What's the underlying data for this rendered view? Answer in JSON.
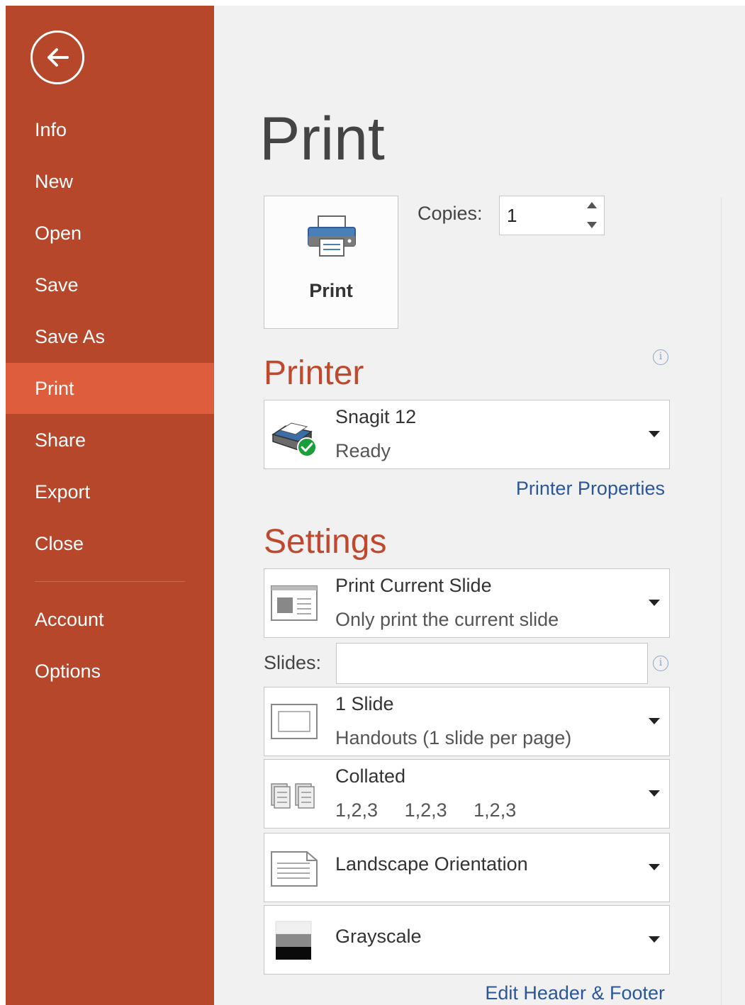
{
  "sidebar": {
    "items": [
      {
        "label": "Info"
      },
      {
        "label": "New"
      },
      {
        "label": "Open"
      },
      {
        "label": "Save"
      },
      {
        "label": "Save As"
      },
      {
        "label": "Print"
      },
      {
        "label": "Share"
      },
      {
        "label": "Export"
      },
      {
        "label": "Close"
      },
      {
        "label": "Account"
      },
      {
        "label": "Options"
      }
    ],
    "active": "Print"
  },
  "main": {
    "title": "Print",
    "print_button_label": "Print",
    "copies": {
      "label": "Copies:",
      "value": "1"
    },
    "printer": {
      "heading": "Printer",
      "name": "Snagit 12",
      "status": "Ready",
      "properties_link": "Printer Properties"
    },
    "settings": {
      "heading": "Settings",
      "print_range": {
        "title": "Print Current Slide",
        "subtitle": "Only print the current slide"
      },
      "slides": {
        "label": "Slides:",
        "value": ""
      },
      "layout": {
        "title": "1 Slide",
        "subtitle": "Handouts (1 slide per page)"
      },
      "collation": {
        "title": "Collated",
        "sequence": [
          "1,2,3",
          "1,2,3",
          "1,2,3"
        ]
      },
      "orientation": {
        "title": "Landscape Orientation"
      },
      "color": {
        "title": "Grayscale"
      },
      "header_footer_link": "Edit Header & Footer"
    }
  },
  "colors": {
    "sidebar": "#b7472a",
    "sidebar_active": "#dd5d3d",
    "accent_heading": "#c0482d",
    "link": "#2b579a"
  }
}
